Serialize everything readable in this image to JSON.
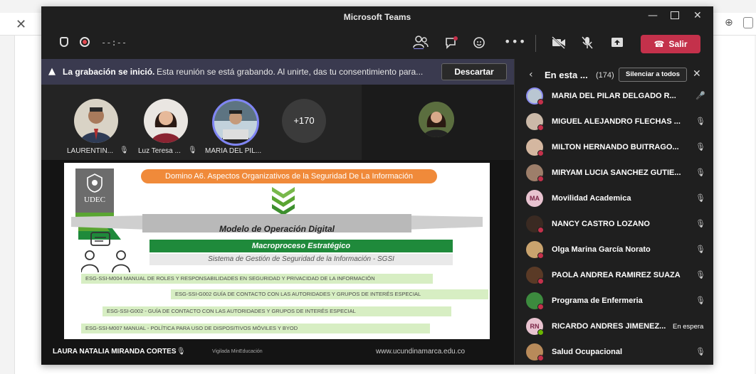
{
  "window": {
    "title": "Microsoft Teams"
  },
  "toolbar": {
    "timer": "--:--",
    "leave_label": "Salir"
  },
  "banner": {
    "bold": "La grabación se inició.",
    "text": "Esta reunión se está grabando. Al unirte, das tu consentimiento para...",
    "dismiss_label": "Descartar"
  },
  "strip": {
    "participants": [
      {
        "name": "LAURENTIN..."
      },
      {
        "name": "Luz Teresa ..."
      },
      {
        "name": "MARIA DEL PIL..."
      }
    ],
    "more": "+170"
  },
  "slide": {
    "banner": "Domino A6. Aspectos Organizativos de la Seguridad De La Información",
    "logo": "UDEC",
    "model": "Modelo de Operación Digital",
    "macro": "Macroproceso Estratégico",
    "sgsi": "Sistema de Gestión de Seguridad de la Información - SGSI",
    "docs": [
      "ESG-SSI-M004 MANUAL DE ROLES Y RESPONSABILIDADES EN SEGURIDAD Y PRIVACIDAD DE LA INFORMACIÓN",
      "ESG-SSI-G002 GUÍA DE CONTACTO CON LAS AUTORIDADES Y GRUPOS DE INTERÉS ESPECIAL",
      "ESG-SSI-G002 - GUÍA DE CONTACTO CON LAS AUTORIDADES Y GRUPOS DE INTERÉS ESPECIAL",
      "ESG-SSI-M007 MANUAL - POLÍTICA PARA USO DE DISPOSITIVOS MÓVILES Y BYOD"
    ],
    "presenter": "LAURA NATALIA MIRANDA CORTES",
    "vigilado": "Vigilada MinEducación",
    "website": "www.ucundinamarca.edu.co"
  },
  "panel": {
    "title": "En esta ...",
    "count": "(174)",
    "mute_all_label": "Silenciar a todos",
    "participants": [
      {
        "name": "MARIA DEL PILAR DELGADO R...",
        "mic": "on"
      },
      {
        "name": "MIGUEL ALEJANDRO FLECHAS ...",
        "mic": "off"
      },
      {
        "name": "MILTON HERNANDO BUITRAGO...",
        "mic": "off"
      },
      {
        "name": "MIRYAM LUCIA SANCHEZ GUTIE...",
        "mic": "off"
      },
      {
        "name": "Movilidad Academica",
        "initials": "MA",
        "mic": "off"
      },
      {
        "name": "NANCY CASTRO LOZANO",
        "mic": "off"
      },
      {
        "name": "Olga Marina García Norato",
        "mic": "off"
      },
      {
        "name": "PAOLA ANDREA RAMIREZ SUAZA",
        "mic": "off"
      },
      {
        "name": "Programa de Enfermeria",
        "mic": "off"
      },
      {
        "name": "RICARDO ANDRES JIMENEZ...",
        "initials": "RN",
        "status": "En espera"
      },
      {
        "name": "Salud Ocupacional",
        "mic": "off"
      }
    ]
  },
  "colors": {
    "leave": "#c4314b",
    "banner": "#3a3a4f",
    "accent": "#5b5fc7",
    "slide_green": "#1f8a3b",
    "slide_orange": "#f08a3a"
  }
}
